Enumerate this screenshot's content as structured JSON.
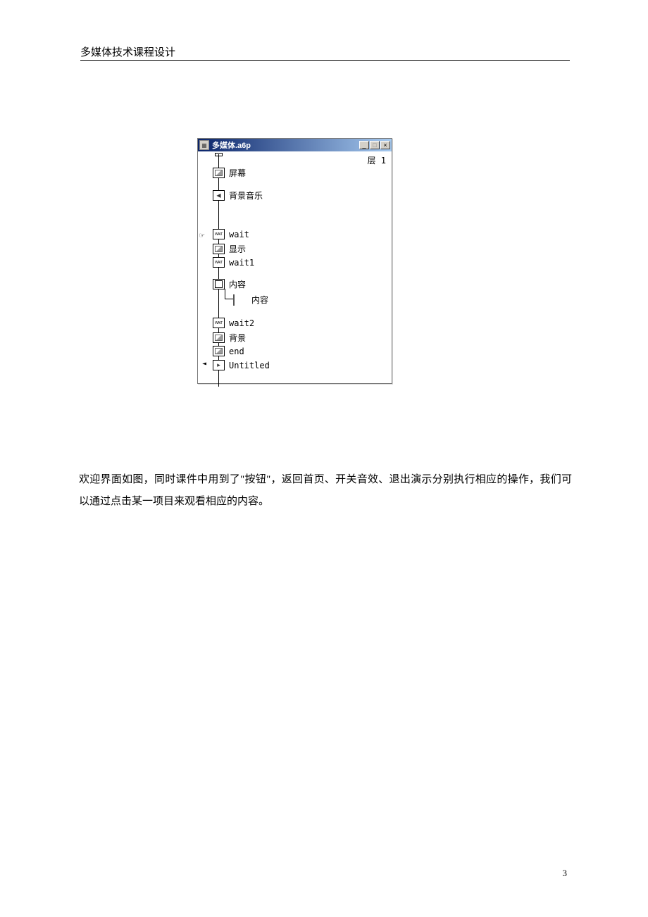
{
  "header": {
    "title": "多媒体技术课程设计"
  },
  "window": {
    "title": "多媒体.a6p",
    "layer_label": "层 1",
    "controls": {
      "min": "_",
      "max": "□",
      "close": "×"
    },
    "nodes": {
      "n1": "屏幕",
      "n2": "背景音乐",
      "n3": "wait",
      "n4": "显示",
      "n5": "wait1",
      "n6": "内容",
      "n6_sub": "内容",
      "n7": "wait2",
      "n8": "背景",
      "n9": "end",
      "n10": "Untitled"
    },
    "wait_text": "WAIT"
  },
  "body": {
    "paragraph": "欢迎界面如图，同时课件中用到了\"按钮\"，返回首页、开关音效、退出演示分别执行相应的操作，我们可以通过点击某一项目来观看相应的内容。"
  },
  "page_number": "3"
}
